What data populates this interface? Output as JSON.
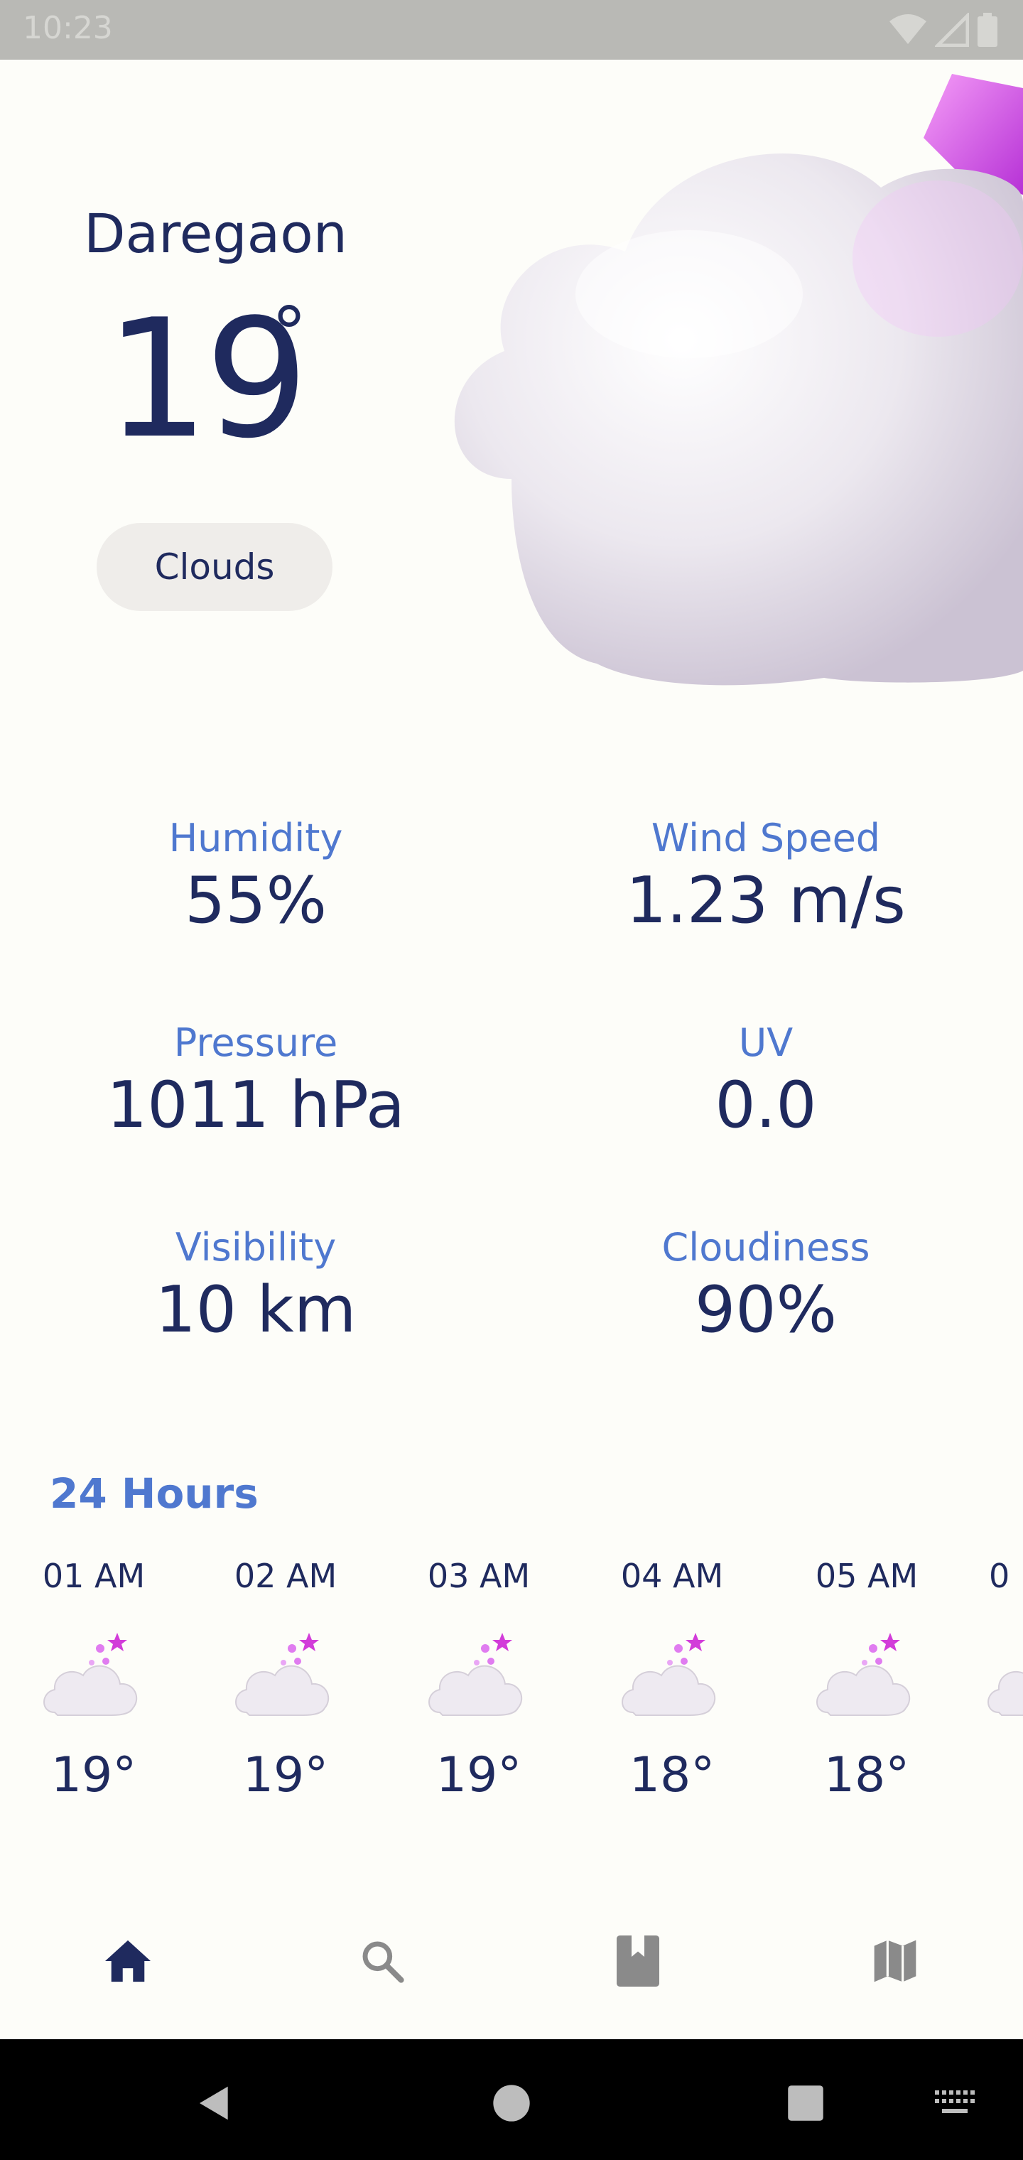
{
  "status_bar": {
    "time": "10:23",
    "icons": [
      "wifi-icon",
      "signal-icon",
      "battery-icon"
    ]
  },
  "current": {
    "city": "Daregaon",
    "temperature": "19",
    "degree_symbol": "°",
    "condition": "Clouds",
    "hero_icon": "cloud-with-moon-stars"
  },
  "stats": [
    {
      "label": "Humidity",
      "value": "55%"
    },
    {
      "label": "Wind Speed",
      "value": "1.23 m/s"
    },
    {
      "label": "Pressure",
      "value": "1011 hPa"
    },
    {
      "label": "UV",
      "value": "0.0"
    },
    {
      "label": "Visibility",
      "value": "10 km"
    },
    {
      "label": "Cloudiness",
      "value": "90%"
    }
  ],
  "hourly": {
    "title": "24 Hours",
    "items": [
      {
        "time": "01 AM",
        "temp": "19°",
        "icon": "cloud-night-icon"
      },
      {
        "time": "02 AM",
        "temp": "19°",
        "icon": "cloud-night-icon"
      },
      {
        "time": "03 AM",
        "temp": "19°",
        "icon": "cloud-night-icon"
      },
      {
        "time": "04 AM",
        "temp": "18°",
        "icon": "cloud-night-icon"
      },
      {
        "time": "05 AM",
        "temp": "18°",
        "icon": "cloud-night-icon"
      },
      {
        "time": "0",
        "temp": "",
        "icon": "cloud-night-icon"
      }
    ]
  },
  "bottom_nav": [
    {
      "icon": "home-icon",
      "active": true
    },
    {
      "icon": "search-icon",
      "active": false
    },
    {
      "icon": "bookmark-icon",
      "active": false
    },
    {
      "icon": "map-icon",
      "active": false
    }
  ],
  "system_nav": [
    "back-icon",
    "home-circle-icon",
    "recents-icon",
    "keyboard-icon"
  ],
  "colors": {
    "background": "#fdfdf9",
    "primary_text": "#1f2a5e",
    "accent_label": "#4f78cf",
    "chip_bg": "#efedea",
    "nav_inactive": "#8a8a8a"
  }
}
